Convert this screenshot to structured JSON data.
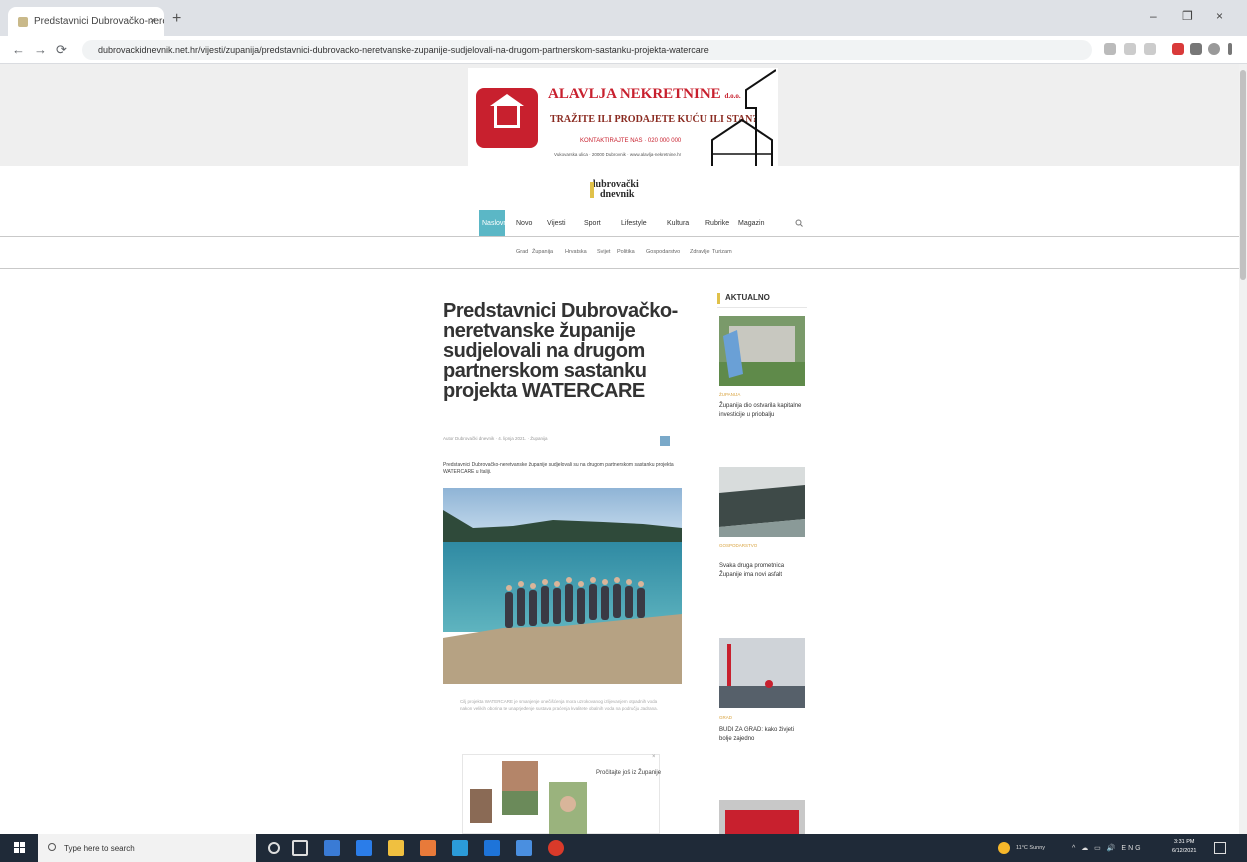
{
  "browser": {
    "tab_title": "Predstavnici Dubrovačko-nere",
    "tab_close": "×",
    "new_tab": "+",
    "window_controls": {
      "minimize": "–",
      "restore": "❐",
      "close": "×"
    },
    "nav": {
      "back": "←",
      "forward": "→",
      "reload": "⟳"
    },
    "url": "dubrovackidnevnik.net.hr/vijesti/zupanija/predstavnici-dubrovacko-neretvanske-zupanije-sudjelovali-na-drugom-partnerskom-sastanku-projekta-watercare"
  },
  "banner": {
    "title": "ALAVLJA NEKRETNINE",
    "title_suffix": "d.o.o.",
    "tagline": "TRAŽITE ILI PRODAJETE KUĆU ILI STAN?",
    "phone_line": "KONTAKTIRAJTE NAS · 020 000 000",
    "address_line": "Vukovarska ulica · 20000 Dubrovnik · www.alavlja-nekretnine.hr"
  },
  "site": {
    "logo_line1": "dubrovački",
    "logo_line2": "dnevnik"
  },
  "main_nav": [
    "Naslovna",
    "Novo",
    "Vijesti",
    "Sport",
    "Lifestyle",
    "Kultura",
    "Rubrike",
    "Magazin"
  ],
  "sub_nav": [
    "Grad",
    "Županija",
    "Hrvatska",
    "Svijet",
    "Politika",
    "Gospodarstvo",
    "Zdravlje",
    "Turizam"
  ],
  "article": {
    "title": "Predstavnici Dubrovačko-neretvanske županije sudjelovali na drugom partnerskom sastanku projekta WATERCARE",
    "meta": "Autor Dubrovački dnevnik · 4. lipnja 2021. · Županija",
    "lead": "Predstavnici Dubrovačko-neretvanske županije sudjelovali su na drugom partnerskom sastanku projekta WATERCARE u Italiji.",
    "caption": "Cilj projekta WATERCARE je smanjenje onečišćenja mora uzrokovanog izlijevanjem otpadnih voda nakon velikih oborina te unaprjeđenje sustava praćenja kvalitete obalnih voda na području Jadrana.",
    "related_title": "Pročitajte još iz Županije",
    "related_close": "×"
  },
  "sidebar": {
    "heading": "AKTUALNO",
    "items": [
      {
        "category": "ŽUPANIJA",
        "title": "Županija dio ostvarila kapitalne investicije u priobalju"
      },
      {
        "category": "GOSPODARSTVO",
        "title": "Svaka druga prometnica Županije ima novi asfalt"
      },
      {
        "category": "GRAD",
        "title": "BUDI ZA GRAD: kako živjeti bolje zajedno"
      }
    ]
  },
  "taskbar": {
    "search_placeholder": "Type here to search",
    "weather": "11°C Sunny",
    "tray": "^ ☁ ▭ 🔊 ENG",
    "time": "3:31 PM",
    "date": "6/12/2021"
  },
  "colors": {
    "accent": "#5bb7c6",
    "brand_red": "#c8202e",
    "gold": "#e0c14a",
    "taskbar": "#1f2a38"
  },
  "icons": [
    "back-icon",
    "forward-icon",
    "reload-icon",
    "lock-icon",
    "star-icon",
    "windows-icon",
    "search-icon"
  ]
}
